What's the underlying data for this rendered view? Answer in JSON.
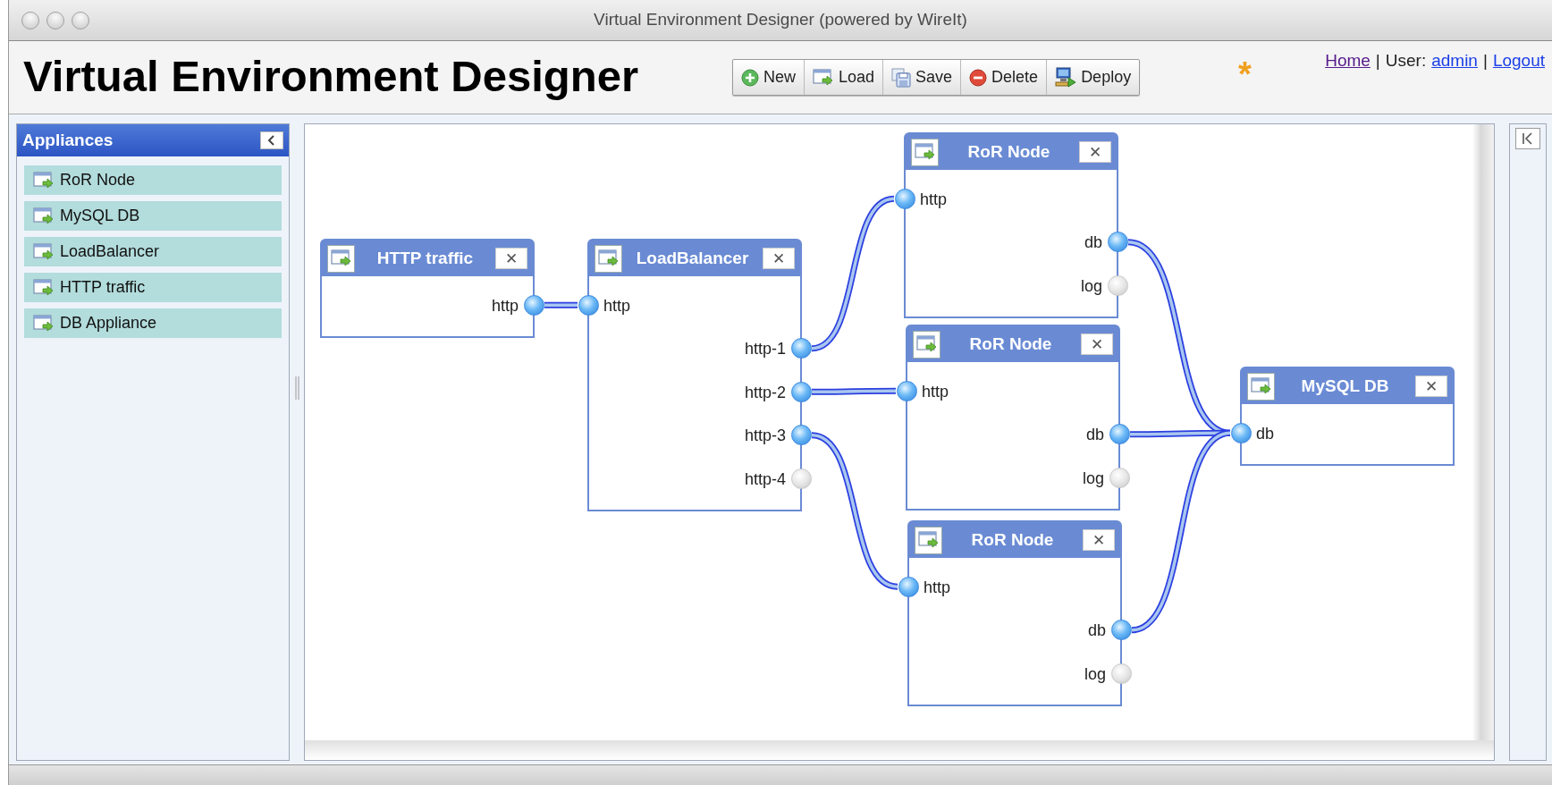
{
  "window": {
    "title": "Virtual Environment Designer (powered by WireIt)"
  },
  "header": {
    "title": "Virtual Environment Designer",
    "toolbar": [
      {
        "kind": "new",
        "label": "New"
      },
      {
        "kind": "load",
        "label": "Load"
      },
      {
        "kind": "save",
        "label": "Save"
      },
      {
        "kind": "delete",
        "label": "Delete"
      },
      {
        "kind": "deploy",
        "label": "Deploy"
      }
    ],
    "unsaved_mark": "*",
    "user_links": [
      {
        "kind": "link",
        "text": "Home",
        "visited": true
      },
      {
        "kind": "text",
        "text": "|"
      },
      {
        "kind": "text",
        "text": "User:"
      },
      {
        "kind": "link",
        "text": "admin",
        "visited": false
      },
      {
        "kind": "text",
        "text": "|"
      },
      {
        "kind": "link",
        "text": "Logout",
        "visited": false
      }
    ]
  },
  "sidebar": {
    "title": "Appliances",
    "items": [
      "RoR Node",
      "MySQL DB",
      "LoadBalancer",
      "HTTP traffic",
      "DB Appliance"
    ]
  },
  "canvas": {
    "nodes": [
      {
        "title": "HTTP traffic",
        "close": "✕",
        "terminals": [
          {
            "label": "http",
            "kind": "output",
            "connected": true
          }
        ]
      },
      {
        "title": "LoadBalancer",
        "close": "✕",
        "terminals": [
          {
            "label": "http",
            "kind": "input",
            "connected": true
          },
          {
            "label": "http-1",
            "kind": "output",
            "connected": true
          },
          {
            "label": "http-2",
            "kind": "output",
            "connected": true
          },
          {
            "label": "http-3",
            "kind": "output",
            "connected": true
          },
          {
            "label": "http-4",
            "kind": "output",
            "connected": false
          }
        ]
      },
      {
        "title": "RoR Node",
        "close": "✕",
        "terminals": [
          {
            "label": "http",
            "kind": "input",
            "connected": true
          },
          {
            "label": "db",
            "kind": "output",
            "connected": true
          },
          {
            "label": "log",
            "kind": "output",
            "connected": false
          }
        ]
      },
      {
        "title": "RoR Node",
        "close": "✕",
        "terminals": [
          {
            "label": "http",
            "kind": "input",
            "connected": true
          },
          {
            "label": "db",
            "kind": "output",
            "connected": true
          },
          {
            "label": "log",
            "kind": "output",
            "connected": false
          }
        ]
      },
      {
        "title": "RoR Node",
        "close": "✕",
        "terminals": [
          {
            "label": "http",
            "kind": "input",
            "connected": true
          },
          {
            "label": "db",
            "kind": "output",
            "connected": true
          },
          {
            "label": "log",
            "kind": "output",
            "connected": false
          }
        ]
      },
      {
        "title": "MySQL DB",
        "close": "✕",
        "terminals": [
          {
            "label": "db",
            "kind": "input",
            "connected": true
          }
        ]
      }
    ]
  }
}
